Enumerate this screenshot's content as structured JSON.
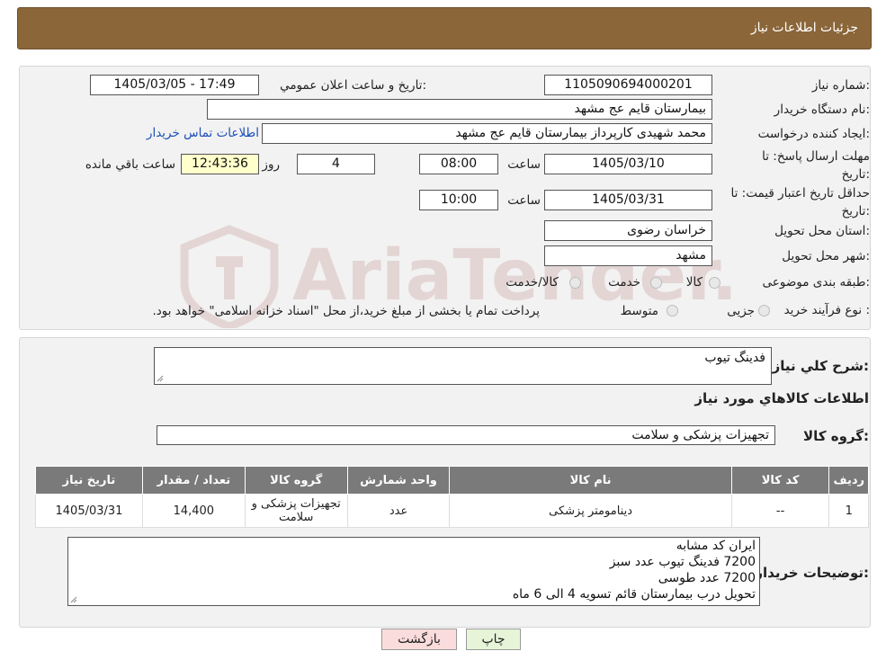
{
  "header": {
    "title": "جزئیات اطلاعات نیاز"
  },
  "form": {
    "need_number_label": "شماره نیاز:",
    "need_number": "1105090694000201",
    "announce_label": "تاریخ و ساعت اعلان عمومي:",
    "announce_value": "1405/03/05 - 17:49",
    "buyer_org_label": "نام دستگاه خريدار:",
    "buyer_org": "بیمارستان قایم  عج  مشهد",
    "creator_label": "ایجاد کننده درخواست:",
    "creator": "محمد شهیدی کارپرداز بیمارستان قایم  عج  مشهد",
    "contact_link": "اطلاعات تماس خریدار",
    "deadline_label": "مهلت ارسال پاسخ: تا تاریخ:",
    "deadline_date": "1405/03/10",
    "time_label": "ساعت",
    "deadline_time": "08:00",
    "days_value": "4",
    "days_label": "روز و",
    "remaining_time": "12:43:36",
    "remaining_label": "ساعت باقي مانده",
    "validity_label": "حداقل تاريخ اعتبار قيمت: تا تاریخ:",
    "validity_date": "1405/03/31",
    "validity_time": "10:00",
    "province_label": "استان محل تحویل:",
    "province": "خراسان رضوی",
    "city_label": "شهر محل تحویل:",
    "city": "مشهد",
    "category_label": "طبقه بندی موضوعی:",
    "category_options": [
      "کالا",
      "خدمت",
      "کالا/خدمت"
    ],
    "process_label": "نوع فرآیند خرید :",
    "process_options": [
      "جزیی",
      "متوسط"
    ],
    "process_note": "پرداخت تمام یا بخشی از مبلغ خرید،از محل \"اسناد خزانه اسلامی\" خواهد بود."
  },
  "summary": {
    "desc_label": "شرح کلي نياز:",
    "desc_value": "فدینگ تیوب",
    "items_title": "اطلاعات کالاهاي مورد نياز",
    "group_label": "گروه کالا:",
    "group_value": "تجهیزات پزشکی و سلامت"
  },
  "table": {
    "headers": [
      "رديف",
      "کد کالا",
      "نام کالا",
      "واحد شمارش",
      "گروه کالا",
      "تعداد / مقدار",
      "تاریخ نیاز"
    ],
    "rows": [
      [
        "1",
        "--",
        "دینامومتر پزشکی",
        "عدد",
        "تجهیزات پزشکی و سلامت",
        "14,400",
        "1405/03/31"
      ]
    ]
  },
  "notes": {
    "label": "توضیحات خریدار:",
    "lines": [
      "ایران کد مشابه",
      "7200  فدینگ تیوب عدد سبز",
      "7200 عدد طوسی",
      "تحویل درب بیمارستان  قائم  تسویه 4 الی 6 ماه"
    ]
  },
  "buttons": {
    "print": "چاپ",
    "back": "بازگشت"
  },
  "watermark": {
    "text": "AriaTender.neT"
  },
  "colors": {
    "header": "#8b6639",
    "print_btn": "#e6f5d8",
    "back_btn": "#fbdcdc",
    "link": "#1a4fb5"
  }
}
